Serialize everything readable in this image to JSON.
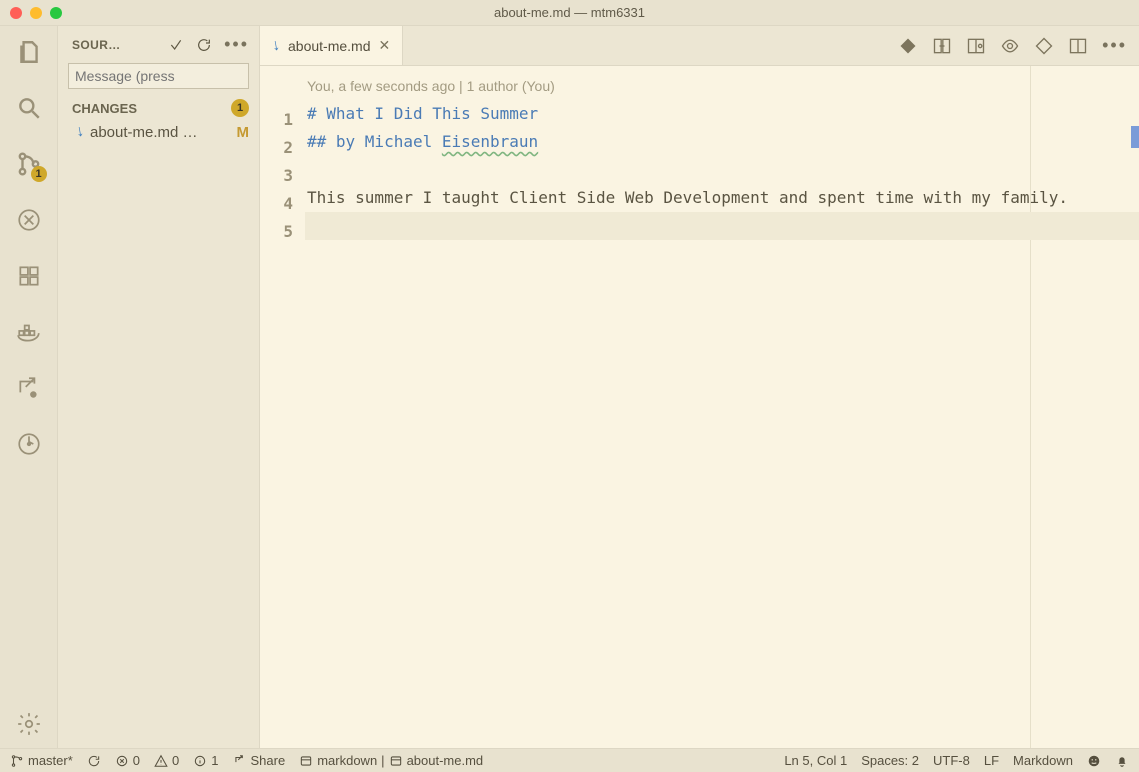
{
  "titlebar": {
    "title": "about-me.md — mtm6331"
  },
  "activitybar": {
    "scm_badge": "1"
  },
  "sidebar": {
    "title": "SOUR…",
    "message_placeholder": "Message (press",
    "changes_label": "CHANGES",
    "changes_count": "1",
    "file": {
      "name": "about-me.md …",
      "status": "M"
    }
  },
  "tab": {
    "name": "about-me.md"
  },
  "editor": {
    "blame": "You, a few seconds ago | 1 author (You)",
    "lines": {
      "l1": "1",
      "l2": "2",
      "l3": "3",
      "l4": "4",
      "l5": "5"
    },
    "code": {
      "c1a": "# What I Did This Summer",
      "c2a": "## by Michael ",
      "c2b": "Eisenbraun",
      "c4": "This summer I taught Client Side Web Development and spent time with my family."
    }
  },
  "statusbar": {
    "branch": "master*",
    "errors": "0",
    "warnings": "0",
    "info": "1",
    "share": "Share",
    "bc1": "markdown",
    "bc2": "about-me.md",
    "pos": "Ln 5, Col 1",
    "spaces": "Spaces: 2",
    "encoding": "UTF-8",
    "eol": "LF",
    "lang": "Markdown"
  }
}
